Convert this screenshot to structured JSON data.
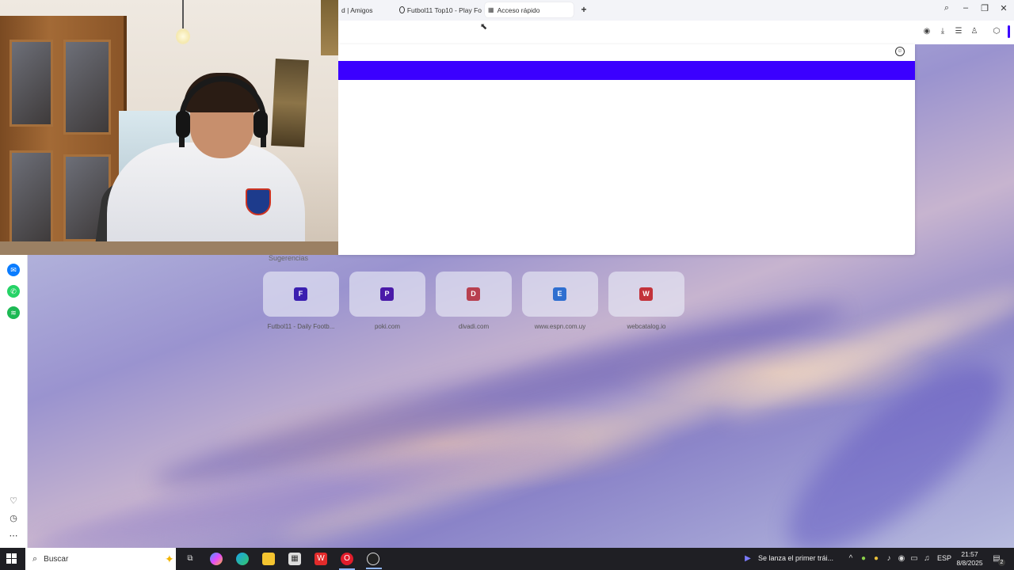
{
  "browser": {
    "tabs": [
      {
        "label": "d | Amigos"
      },
      {
        "label": "Futbol11 Top10 - Play Fo"
      },
      {
        "label": "Acceso rápido"
      }
    ],
    "new_tab_icon": "plus-icon"
  },
  "speed_dial": {
    "section_label": "Sugerencias",
    "tiles": [
      {
        "letter": "F",
        "label": "Futbol11 - Daily Footb...",
        "color": "#3a1fb0"
      },
      {
        "letter": "P",
        "label": "poki.com",
        "color": "#4a1aa8"
      },
      {
        "letter": "D",
        "label": "divadi.com",
        "color": "#b8404f"
      },
      {
        "letter": "E",
        "label": "www.espn.com.uy",
        "color": "#2f6fd0"
      },
      {
        "letter": "W",
        "label": "webcatalog.io",
        "color": "#c3323a"
      }
    ]
  },
  "overlay": {
    "bar_color": "#3b00ff"
  },
  "taskbar": {
    "search_placeholder": "Buscar",
    "news_text": "Se lanza el primer trái...",
    "language": "ESP",
    "time": "21:57",
    "date": "8/8/2025",
    "notification_count": "2"
  }
}
